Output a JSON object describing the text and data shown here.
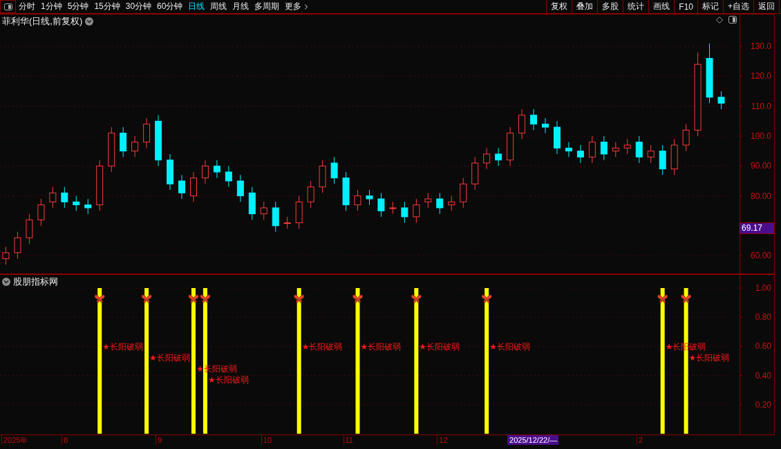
{
  "toolbar": {
    "periods": [
      {
        "label": "分时",
        "selected": false
      },
      {
        "label": "1分钟",
        "selected": false
      },
      {
        "label": "5分钟",
        "selected": false
      },
      {
        "label": "15分钟",
        "selected": false
      },
      {
        "label": "30分钟",
        "selected": false
      },
      {
        "label": "60分钟",
        "selected": false
      },
      {
        "label": "日线",
        "selected": true
      },
      {
        "label": "周线",
        "selected": false
      },
      {
        "label": "月线",
        "selected": false
      },
      {
        "label": "多周期",
        "selected": false
      }
    ],
    "more": "更多",
    "buttons": [
      "复权",
      "叠加",
      "多股",
      "统计",
      "画线",
      "F10",
      "标记",
      "+自选",
      "返回"
    ]
  },
  "main_chart": {
    "title": "菲利华(日线,前复权)",
    "price_tag": "69.17",
    "chart_data": {
      "type": "candlestick",
      "ylim": [
        53.8,
        140.9
      ],
      "grid": true,
      "yticks": [
        {
          "value": 60,
          "label": "60.00"
        },
        {
          "value": 80,
          "label": "80.00"
        },
        {
          "value": 90,
          "label": "90.00"
        },
        {
          "value": 100,
          "label": "100.0"
        },
        {
          "value": 110,
          "label": "110.0"
        },
        {
          "value": 120,
          "label": "120.0"
        },
        {
          "value": 130,
          "label": "130.0"
        }
      ],
      "ohlc": [
        [
          59,
          63,
          57,
          61
        ],
        [
          61,
          68,
          59,
          66
        ],
        [
          66,
          74,
          64,
          72
        ],
        [
          72,
          79,
          70,
          77
        ],
        [
          78,
          83,
          76,
          81
        ],
        [
          81,
          83,
          76,
          78
        ],
        [
          78,
          80,
          75,
          77
        ],
        [
          77,
          79,
          74,
          76
        ],
        [
          77,
          92,
          75,
          90
        ],
        [
          90,
          103,
          88,
          101
        ],
        [
          101,
          103,
          93,
          95
        ],
        [
          95,
          100,
          93,
          98
        ],
        [
          98,
          106,
          96,
          104
        ],
        [
          105,
          107,
          90,
          92
        ],
        [
          92,
          94,
          82,
          84
        ],
        [
          85,
          87,
          79,
          81
        ],
        [
          80,
          88,
          78,
          86
        ],
        [
          86,
          92,
          84,
          90
        ],
        [
          90,
          92,
          86,
          88
        ],
        [
          88,
          90,
          83,
          85
        ],
        [
          85,
          87,
          78,
          80
        ],
        [
          81,
          83,
          72,
          74
        ],
        [
          74,
          78,
          72,
          76
        ],
        [
          76,
          78,
          68,
          70
        ],
        [
          71,
          73,
          69,
          71
        ],
        [
          71,
          80,
          69,
          78
        ],
        [
          78,
          85,
          76,
          83
        ],
        [
          83,
          92,
          81,
          90
        ],
        [
          91,
          93,
          84,
          86
        ],
        [
          86,
          88,
          75,
          77
        ],
        [
          77,
          82,
          75,
          80
        ],
        [
          80,
          82,
          77,
          79
        ],
        [
          79,
          81,
          73,
          75
        ],
        [
          76,
          78,
          74,
          76
        ],
        [
          76,
          78,
          71,
          73
        ],
        [
          73,
          79,
          71,
          77
        ],
        [
          78,
          81,
          76,
          79
        ],
        [
          79,
          81,
          74,
          76
        ],
        [
          77,
          80,
          75,
          78
        ],
        [
          78,
          86,
          76,
          84
        ],
        [
          84,
          93,
          82,
          91
        ],
        [
          91,
          96,
          89,
          94
        ],
        [
          94,
          96,
          90,
          92
        ],
        [
          92,
          103,
          90,
          101
        ],
        [
          101,
          109,
          99,
          107
        ],
        [
          107,
          109,
          102,
          104
        ],
        [
          104,
          106,
          101,
          103
        ],
        [
          103,
          105,
          94,
          96
        ],
        [
          96,
          98,
          93,
          95
        ],
        [
          95,
          97,
          91,
          93
        ],
        [
          93,
          100,
          91,
          98
        ],
        [
          98,
          100,
          92,
          94
        ],
        [
          95,
          98,
          93,
          96
        ],
        [
          96,
          99,
          94,
          97
        ],
        [
          98,
          100,
          91,
          93
        ],
        [
          93,
          97,
          91,
          95
        ],
        [
          95,
          97,
          87,
          89
        ],
        [
          89,
          99,
          87,
          97
        ],
        [
          97,
          104,
          95,
          102
        ],
        [
          102,
          128,
          100,
          124
        ],
        [
          126,
          131,
          111,
          113
        ],
        [
          113,
          115,
          109,
          111
        ]
      ]
    }
  },
  "indicator": {
    "title": "股朋指标网",
    "signal_labels": [
      "★长阳破弱",
      "★长阳破弱",
      "★长阳破弱",
      "★长阳破弱",
      "★长阳破弱",
      "★长阳破弱",
      "★长阳破弱",
      "★长阳破弱",
      "★长阳破弱",
      "★长阳破弱"
    ],
    "chart_data": {
      "type": "bar",
      "ylim": [
        -0.01,
        1.095
      ],
      "grid": true,
      "yticks": [
        {
          "value": 0.2,
          "label": "0.20"
        },
        {
          "value": 0.4,
          "label": "0.40"
        },
        {
          "value": 0.6,
          "label": "0.60"
        },
        {
          "value": 0.8,
          "label": "0.80"
        },
        {
          "value": 1,
          "label": "1.00"
        }
      ],
      "series": [
        {
          "color": "#ffff00",
          "values": [
            0,
            0,
            0,
            0,
            0,
            0,
            0,
            0,
            1,
            0,
            0,
            0,
            1,
            0,
            0,
            0,
            1,
            1,
            0,
            0,
            0,
            0,
            0,
            0,
            0,
            1,
            0,
            0,
            0,
            0,
            1,
            0,
            0,
            0,
            0,
            1,
            0,
            0,
            0,
            0,
            0,
            1,
            0,
            0,
            0,
            0,
            0,
            0,
            0,
            0,
            0,
            0,
            0,
            0,
            0,
            0,
            1,
            0,
            1,
            0,
            0,
            0
          ]
        }
      ]
    }
  },
  "date_axis": [
    {
      "text": "2025年",
      "highlighted": false
    },
    {
      "text": "8",
      "highlighted": false
    },
    {
      "text": "9",
      "highlighted": false
    },
    {
      "text": "10",
      "highlighted": false
    },
    {
      "text": "11",
      "highlighted": false
    },
    {
      "text": "12",
      "highlighted": false
    },
    {
      "text": "2025/12/22/—",
      "highlighted": true
    },
    {
      "text": "2",
      "highlighted": false
    }
  ]
}
